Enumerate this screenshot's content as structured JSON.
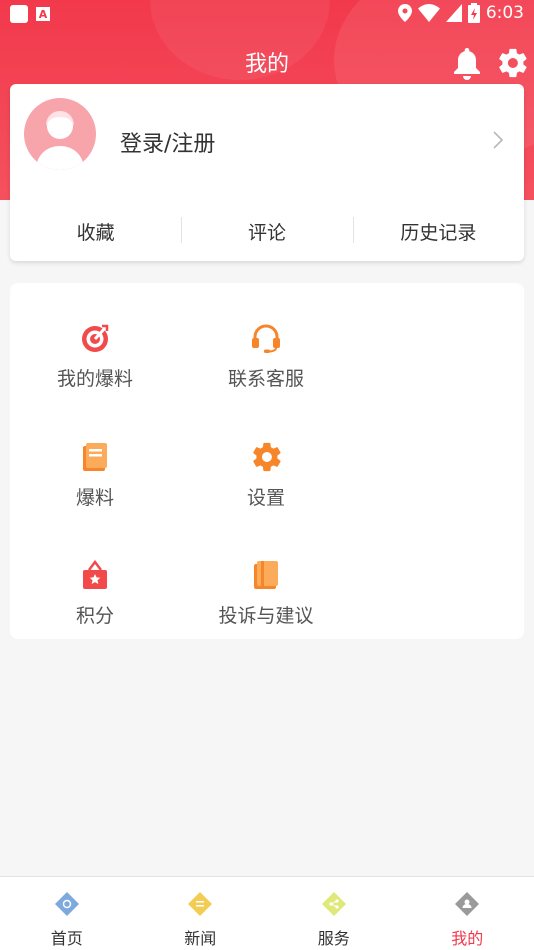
{
  "status_bar": {
    "time": "6:03"
  },
  "header": {
    "title": "我的"
  },
  "profile": {
    "login_label": "登录/注册"
  },
  "stats": [
    {
      "label": "收藏"
    },
    {
      "label": "评论"
    },
    {
      "label": "历史记录"
    }
  ],
  "menu": [
    {
      "label": "我的爆料",
      "icon": "target-icon"
    },
    {
      "label": "联系客服",
      "icon": "headset-icon"
    },
    {
      "label": "爆料",
      "icon": "notebook-icon"
    },
    {
      "label": "设置",
      "icon": "gear-icon"
    },
    {
      "label": "积分",
      "icon": "gift-badge-icon"
    },
    {
      "label": "投诉与建议",
      "icon": "book-icon"
    }
  ],
  "tabbar": [
    {
      "label": "首页",
      "icon": "home-diamond-icon",
      "active": false
    },
    {
      "label": "新闻",
      "icon": "news-diamond-icon",
      "active": false
    },
    {
      "label": "服务",
      "icon": "share-diamond-icon",
      "active": false
    },
    {
      "label": "我的",
      "icon": "user-diamond-icon",
      "active": true
    }
  ],
  "colors": {
    "accent": "#f2394c",
    "orange": "#f7852a",
    "red_icon": "#f24a4a"
  }
}
